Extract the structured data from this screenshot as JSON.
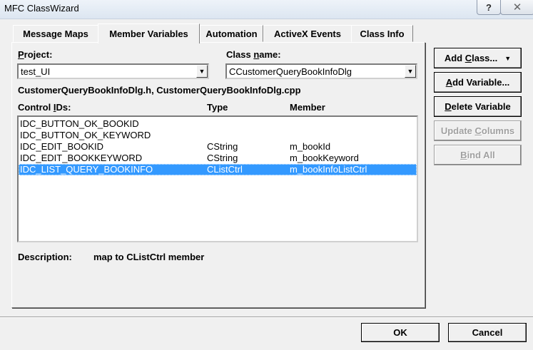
{
  "window": {
    "title": "MFC ClassWizard",
    "help_glyph": "?",
    "close_glyph": "✕"
  },
  "tabs": [
    {
      "label": "Message Maps"
    },
    {
      "label": "Member Variables",
      "active": true
    },
    {
      "label": "Automation"
    },
    {
      "label": "ActiveX Events"
    },
    {
      "label": "Class Info"
    }
  ],
  "project": {
    "label_accel": "P",
    "label_rest": "roject:",
    "value": "test_UI"
  },
  "class_name": {
    "label_pre": "Class ",
    "label_accel": "n",
    "label_rest": "ame:",
    "value": "CCustomerQueryBookInfoDlg"
  },
  "files_text": "CustomerQueryBookInfoDlg.h, CustomerQueryBookInfoDlg.cpp",
  "columns": {
    "control_ids_pre": "Control ",
    "control_ids_accel": "I",
    "control_ids_rest": "Ds:",
    "type": "Type",
    "member": "Member"
  },
  "rows": [
    {
      "id": "IDC_BUTTON_OK_BOOKID",
      "type": "",
      "member": ""
    },
    {
      "id": "IDC_BUTTON_OK_KEYWORD",
      "type": "",
      "member": ""
    },
    {
      "id": "IDC_EDIT_BOOKID",
      "type": "CString",
      "member": "m_bookId"
    },
    {
      "id": "IDC_EDIT_BOOKKEYWORD",
      "type": "CString",
      "member": "m_bookKeyword"
    },
    {
      "id": "IDC_LIST_QUERY_BOOKINFO",
      "type": "CListCtrl",
      "member": "m_bookInfoListCtrl",
      "selected": true
    }
  ],
  "description": {
    "label": "Description:",
    "text": "map to CListCtrl member"
  },
  "buttons": {
    "add_class": {
      "pre": "Add ",
      "accel": "C",
      "rest": "lass...",
      "arrow": "▼"
    },
    "add_variable": {
      "accel": "A",
      "rest": "dd Variable..."
    },
    "delete_variable": {
      "accel": "D",
      "rest": "elete Variable"
    },
    "update_columns": {
      "pre": "Update ",
      "accel": "C",
      "rest": "olumns",
      "disabled": true
    },
    "bind_all": {
      "accel": "B",
      "rest": "ind All",
      "disabled": true
    }
  },
  "footer": {
    "ok": "OK",
    "cancel": "Cancel"
  },
  "colors": {
    "selection": "#3399ff",
    "dialog_bg": "#f0f0f0"
  }
}
